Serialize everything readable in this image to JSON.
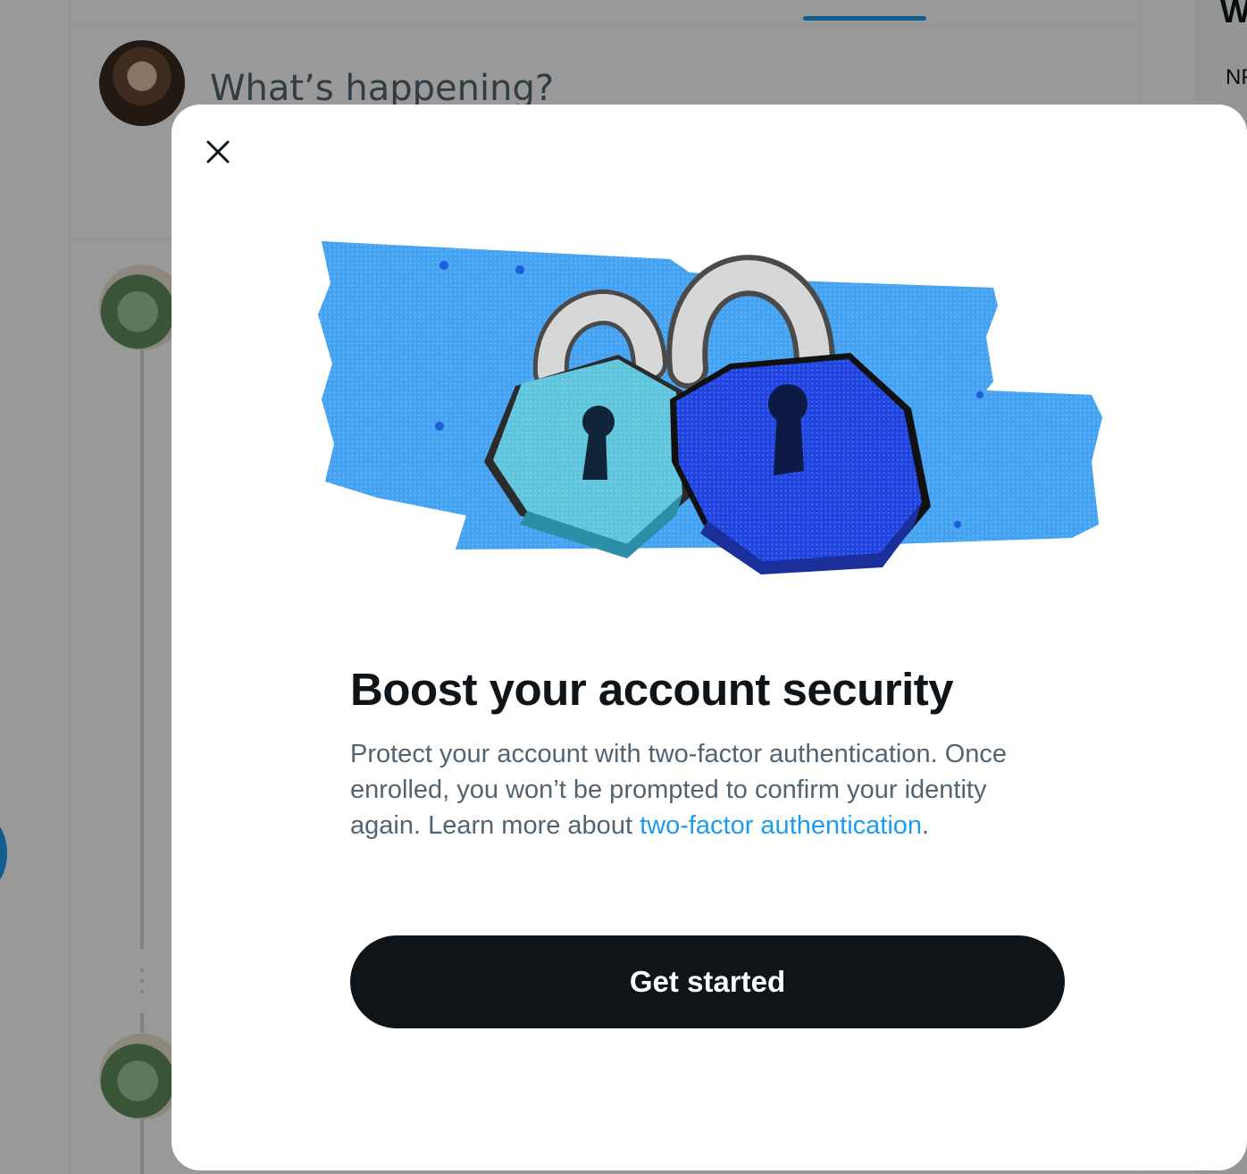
{
  "background": {
    "compose_placeholder": "What’s happening?",
    "right_fragment": "NF"
  },
  "modal": {
    "close_icon": "close-icon",
    "illustration_icon": "padlocks-illustration",
    "title": "Boost your account security",
    "description": {
      "text": "Protect your account with two-factor authentication. Once enrolled, you won’t be prompted to confirm your identity again. Learn more about ",
      "link": "two-factor authentication",
      "suffix": "."
    },
    "cta_label": "Get started"
  },
  "colors": {
    "primary_text": "#0f1419",
    "secondary_text": "#536471",
    "link": "#1d9bf0",
    "button_bg": "#0f1419",
    "lock_light": "#5ec5dd",
    "lock_dark": "#1f44e0",
    "tape": "#2f8cf0"
  }
}
